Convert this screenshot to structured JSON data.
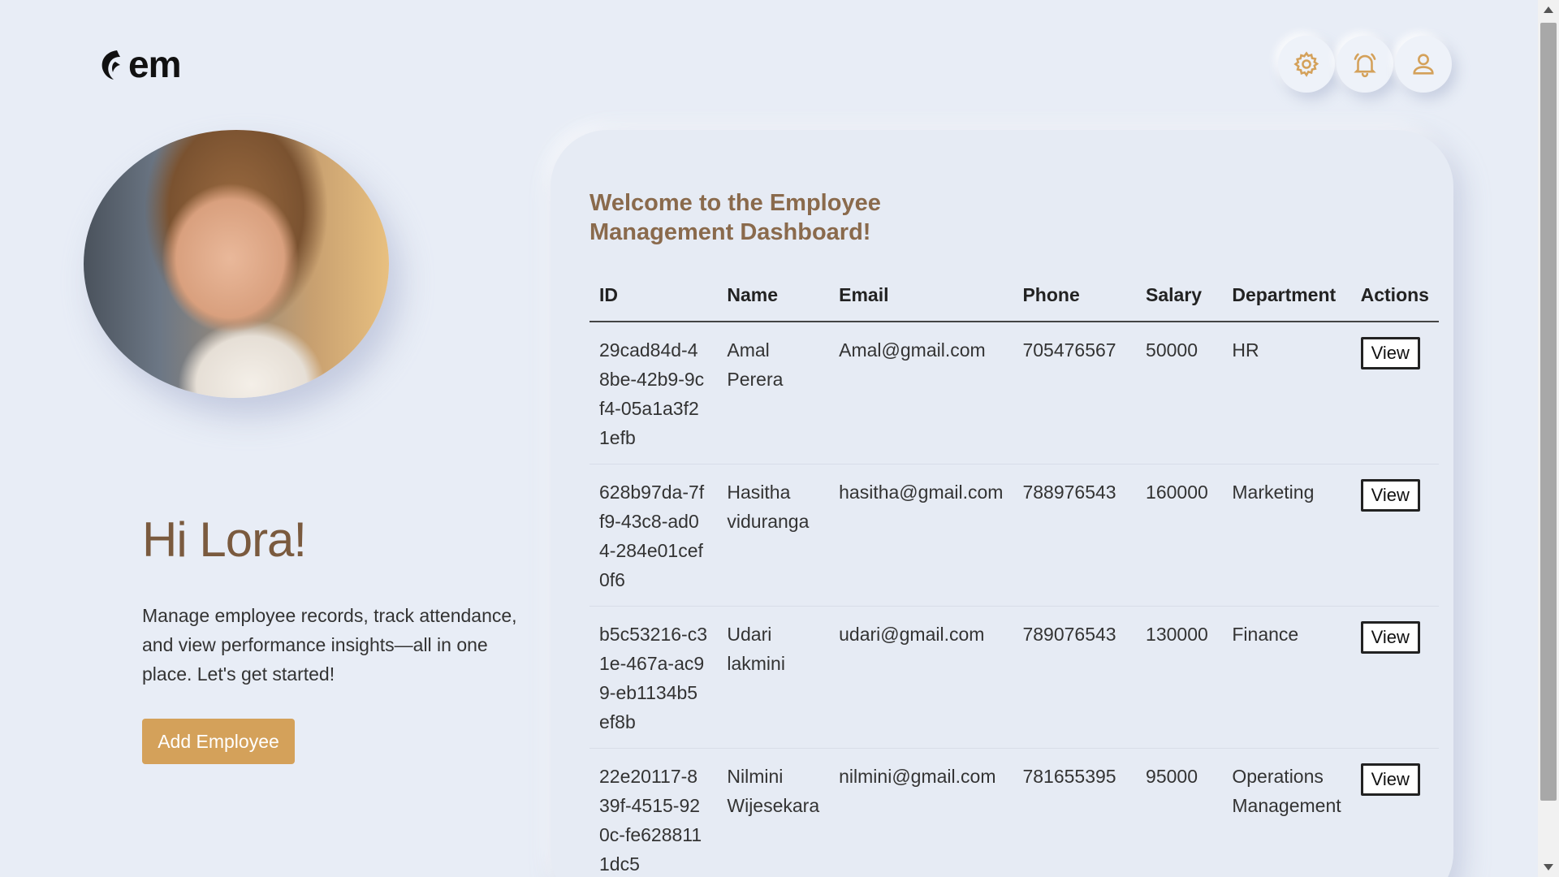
{
  "brand": {
    "logo_text": "em"
  },
  "header": {
    "icons": [
      "settings-icon",
      "bell-icon",
      "user-icon"
    ],
    "accent_color": "#d4a15a"
  },
  "left": {
    "greeting": "Hi Lora!",
    "intro": "Manage employee records, track attendance, and view performance insights—all in one place. Let's get started!",
    "add_button": "Add Employee"
  },
  "card": {
    "title": "Welcome to the Employee Management Dashboard!",
    "columns": [
      "ID",
      "Name",
      "Email",
      "Phone",
      "Salary",
      "Department",
      "Actions"
    ],
    "rows": [
      {
        "id": "29cad84d-48be-42b9-9cf4-05a1a3f21efb",
        "name": "Amal Perera",
        "email": "Amal@gmail.com",
        "phone": "705476567",
        "salary": "50000",
        "department": "HR",
        "action": "View"
      },
      {
        "id": "628b97da-7ff9-43c8-ad04-284e01cef0f6",
        "name": "Hasitha viduranga",
        "email": "hasitha@gmail.com",
        "phone": "788976543",
        "salary": "160000",
        "department": "Marketing",
        "action": "View"
      },
      {
        "id": "b5c53216-c31e-467a-ac99-eb1134b5ef8b",
        "name": "Udari lakmini",
        "email": "udari@gmail.com",
        "phone": "789076543",
        "salary": "130000",
        "department": "Finance",
        "action": "View"
      },
      {
        "id": "22e20117-839f-4515-920c-fe6288111dc5",
        "name": "Nilmini Wijesekara",
        "email": "nilmini@gmail.com",
        "phone": "781655395",
        "salary": "95000",
        "department": "Operations Management",
        "action": "View"
      }
    ]
  },
  "colors": {
    "greeting": "#7a5a3e",
    "title": "#8a6a4c",
    "button": "#d4a15a",
    "background": "#e8edf6"
  }
}
